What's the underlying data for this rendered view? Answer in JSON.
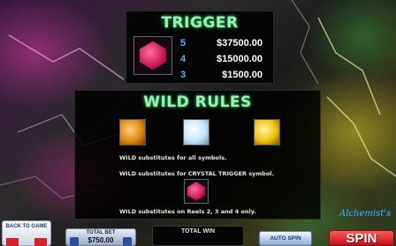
{
  "trigger": {
    "title": "TRIGGER",
    "icon": "red-crystal-icon",
    "payouts": [
      {
        "count": "5",
        "amount": "$37500.00"
      },
      {
        "count": "4",
        "amount": "$15000.00"
      },
      {
        "count": "3",
        "amount": "$1500.00"
      }
    ]
  },
  "wild_rules": {
    "title": "WILD RULES",
    "symbols": [
      "orange-gem-icon",
      "white-gem-icon",
      "yellow-gem-icon"
    ],
    "rule1": "WILD substitutes for all symbols.",
    "rule2": "WILD substitutes for CRYSTAL TRIGGER symbol.",
    "rule3": "WILD substitutes on Reels 2, 3 and 4 only.",
    "rule3_icon": "red-crystal-icon"
  },
  "logo": "Alchemist's",
  "bottom_bar": {
    "back_label": "BACK TO GAME",
    "total_bet_label": "TOTAL BET",
    "total_bet_value": "$750.00",
    "total_win_label": "TOTAL WIN",
    "auto_spin_label": "AUTO SPIN",
    "spin_label": "SPIN"
  },
  "colors": {
    "title_green": "#9cf0b0",
    "count_blue": "#6fa8ff",
    "spin_red": "#d4202a"
  }
}
